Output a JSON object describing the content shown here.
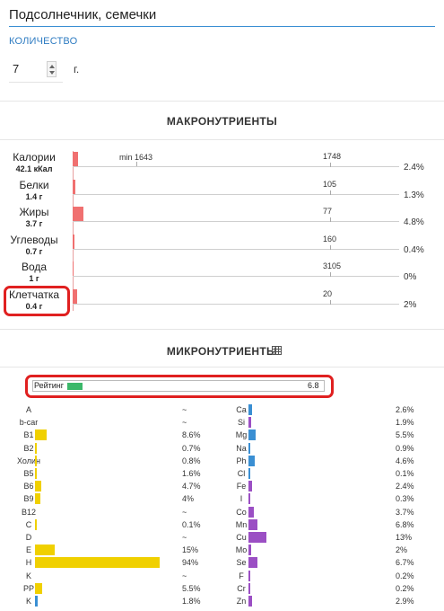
{
  "product": {
    "name": "Подсолнечник, семечки"
  },
  "quantity": {
    "label": "КОЛИЧЕСТВО",
    "value": "7",
    "unit": "г."
  },
  "macro": {
    "title": "МАКРОНУТРИЕНТЫ",
    "min_label": "min 1643",
    "rows": [
      {
        "name": "Калории",
        "amount": "42.1 кКал",
        "norm": "1748",
        "pct": "2.4%",
        "value": 2.4
      },
      {
        "name": "Белки",
        "amount": "1.4 г",
        "norm": "105",
        "pct": "1.3%",
        "value": 1.3
      },
      {
        "name": "Жиры",
        "amount": "3.7 г",
        "norm": "77",
        "pct": "4.8%",
        "value": 4.8
      },
      {
        "name": "Углеводы",
        "amount": "0.7 г",
        "norm": "160",
        "pct": "0.4%",
        "value": 0.4
      },
      {
        "name": "Вода",
        "amount": "1 г",
        "norm": "3105",
        "pct": "0%",
        "value": 0
      },
      {
        "name": "Клетчатка",
        "amount": "0.4 г",
        "norm": "20",
        "pct": "2%",
        "value": 2
      }
    ]
  },
  "micro": {
    "title": "МИКРОНУТРИЕНТЫ",
    "rating": {
      "label": "Рейтинг",
      "value": "6.8",
      "score": 6.8,
      "max": 100,
      "color": "#3cb86a"
    },
    "colors": {
      "vitamin": "#f0d000",
      "mineral_blue": "#3a8fd3",
      "mineral_purple": "#9b4fc4"
    },
    "vitamins": [
      {
        "name": "A",
        "pct": "~",
        "value": 0
      },
      {
        "name": "b-car",
        "pct": "~",
        "value": 0
      },
      {
        "name": "B1",
        "pct": "8.6%",
        "value": 8.6
      },
      {
        "name": "B2",
        "pct": "0.7%",
        "value": 0.7
      },
      {
        "name": "Холин",
        "pct": "0.8%",
        "value": 0.8
      },
      {
        "name": "B5",
        "pct": "1.6%",
        "value": 1.6
      },
      {
        "name": "B6",
        "pct": "4.7%",
        "value": 4.7
      },
      {
        "name": "B9",
        "pct": "4%",
        "value": 4
      },
      {
        "name": "B12",
        "pct": "~",
        "value": 0
      },
      {
        "name": "C",
        "pct": "0.1%",
        "value": 0.1
      },
      {
        "name": "D",
        "pct": "~",
        "value": 0
      },
      {
        "name": "E",
        "pct": "15%",
        "value": 15
      },
      {
        "name": "H",
        "pct": "94%",
        "value": 94
      },
      {
        "name": "K",
        "pct": "~",
        "value": 0
      },
      {
        "name": "PP",
        "pct": "5.5%",
        "value": 5.5
      },
      {
        "name": "K",
        "pct": "1.8%",
        "value": 1.8,
        "color": "blue"
      }
    ],
    "minerals": [
      {
        "name": "Ca",
        "pct": "2.6%",
        "value": 2.6,
        "color": "blue"
      },
      {
        "name": "Si",
        "pct": "1.9%",
        "value": 1.9,
        "color": "purple"
      },
      {
        "name": "Mg",
        "pct": "5.5%",
        "value": 5.5,
        "color": "blue"
      },
      {
        "name": "Na",
        "pct": "0.9%",
        "value": 0.9,
        "color": "blue"
      },
      {
        "name": "Ph",
        "pct": "4.6%",
        "value": 4.6,
        "color": "blue"
      },
      {
        "name": "Cl",
        "pct": "0.1%",
        "value": 0.1,
        "color": "blue"
      },
      {
        "name": "Fe",
        "pct": "2.4%",
        "value": 2.4,
        "color": "purple"
      },
      {
        "name": "I",
        "pct": "0.3%",
        "value": 0.3,
        "color": "purple"
      },
      {
        "name": "Co",
        "pct": "3.7%",
        "value": 3.7,
        "color": "purple"
      },
      {
        "name": "Mn",
        "pct": "6.8%",
        "value": 6.8,
        "color": "purple"
      },
      {
        "name": "Cu",
        "pct": "13%",
        "value": 13,
        "color": "purple"
      },
      {
        "name": "Mo",
        "pct": "2%",
        "value": 2,
        "color": "purple"
      },
      {
        "name": "Se",
        "pct": "6.7%",
        "value": 6.7,
        "color": "purple"
      },
      {
        "name": "F",
        "pct": "0.2%",
        "value": 0.2,
        "color": "purple"
      },
      {
        "name": "Cr",
        "pct": "0.2%",
        "value": 0.2,
        "color": "purple"
      },
      {
        "name": "Zn",
        "pct": "2.9%",
        "value": 2.9,
        "color": "purple"
      }
    ]
  }
}
